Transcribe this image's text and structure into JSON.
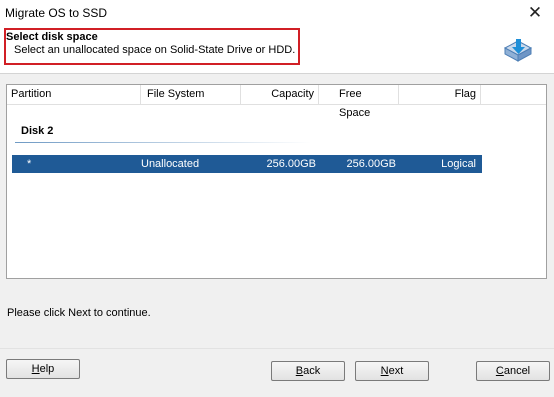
{
  "window": {
    "title": "Migrate OS to SSD"
  },
  "header": {
    "title": "Select disk space",
    "subtitle": "Select an unallocated space on Solid-State Drive or HDD.",
    "icon": "disk-arrow-icon"
  },
  "table": {
    "columns": [
      "Partition",
      "File System",
      "Capacity",
      "Free Space",
      "Flag"
    ],
    "disks": [
      {
        "label": "Disk 2",
        "partitions": [
          {
            "partition": "*",
            "file_system": "Unallocated",
            "capacity": "256.00GB",
            "free_space": "256.00GB",
            "flag": "Logical",
            "selected": true
          }
        ]
      }
    ]
  },
  "status_text": "Please click Next to continue.",
  "buttons": {
    "help": {
      "label": "Help",
      "mnemonic": "H"
    },
    "back": {
      "label": "Back",
      "mnemonic": "B"
    },
    "next": {
      "label": "Next",
      "mnemonic": "N"
    },
    "cancel": {
      "label": "Cancel",
      "mnemonic": "C"
    }
  },
  "colors": {
    "selection": "#1f5a96",
    "highlight_border": "#d11f25",
    "accent": "#2a6fb3"
  }
}
